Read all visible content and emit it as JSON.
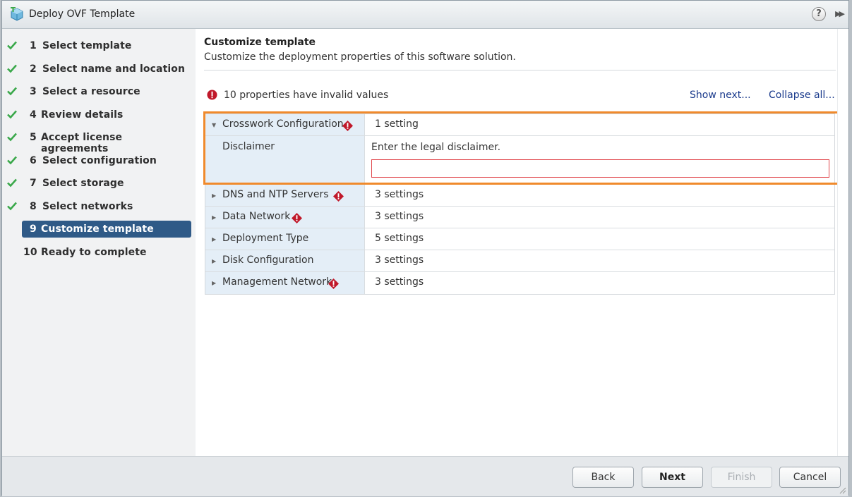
{
  "window": {
    "title": "Deploy OVF Template",
    "help_label": "?",
    "expand_label": "▶▶"
  },
  "steps": [
    {
      "num": "1",
      "label": "Select template",
      "done": true
    },
    {
      "num": "2",
      "label": "Select name and location",
      "done": true
    },
    {
      "num": "3",
      "label": "Select a resource",
      "done": true
    },
    {
      "num": "4",
      "label": "Review details",
      "done": true
    },
    {
      "num": "5",
      "label": "Accept license agreements",
      "done": true
    },
    {
      "num": "6",
      "label": "Select configuration",
      "done": true
    },
    {
      "num": "7",
      "label": "Select storage",
      "done": true
    },
    {
      "num": "8",
      "label": "Select networks",
      "done": true
    },
    {
      "num": "9",
      "label": "Customize template",
      "active": true
    },
    {
      "num": "10",
      "label": "Ready to complete"
    }
  ],
  "main": {
    "title": "Customize template",
    "subtitle": "Customize the deployment properties of this software solution.",
    "invalid_message": "10 properties have invalid values",
    "show_next_label": "Show next...",
    "collapse_all_label": "Collapse all...",
    "groups": [
      {
        "name": "Crosswork Configuration",
        "value": "1 setting",
        "error": true,
        "expanded": true
      },
      {
        "name": "DNS and NTP Servers",
        "value": "3 settings",
        "error": true
      },
      {
        "name": "Data Network",
        "value": "3 settings",
        "error": true
      },
      {
        "name": "Deployment Type",
        "value": "5 settings",
        "error": false
      },
      {
        "name": "Disk Configuration",
        "value": "3 settings",
        "error": false
      },
      {
        "name": "Management Network",
        "value": "3 settings",
        "error": true
      }
    ],
    "disclaimer": {
      "label": "Disclaimer",
      "description": "Enter the legal disclaimer.",
      "value": ""
    }
  },
  "footer": {
    "back_label": "Back",
    "next_label": "Next",
    "finish_label": "Finish",
    "cancel_label": "Cancel"
  },
  "colors": {
    "active_step": "#2f5a87",
    "check": "#3aa84a",
    "error": "#c0182a",
    "highlight": "#f08a2c",
    "link": "#1a3a8c"
  }
}
